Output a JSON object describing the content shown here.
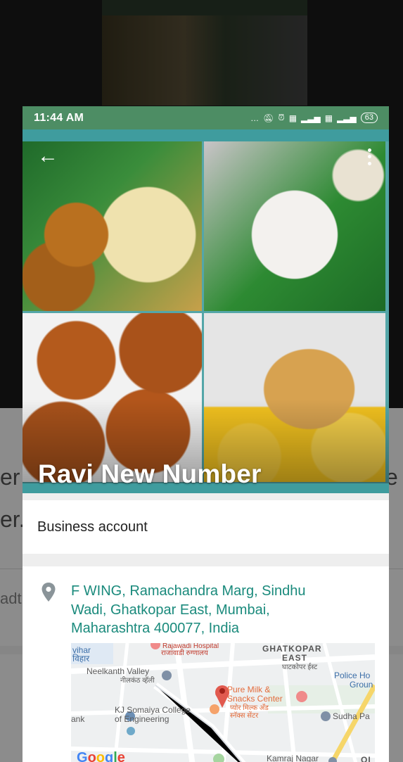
{
  "background": {
    "line1": "er .",
    "line2": "er.",
    "right_char": "e",
    "lower_text": "adt"
  },
  "status_bar": {
    "time": "11:44 AM",
    "icons": [
      "dots-icon",
      "mute-icon",
      "alarm-icon",
      "volte-icon",
      "4g-signal-icon",
      "volte-icon",
      "signal-icon"
    ],
    "battery": "63"
  },
  "hero": {
    "title": "Ravi New Number",
    "photos": [
      "medu-vada-upma-photo",
      "idiyappam-photo",
      "masala-vada-photo",
      "dosa-cone-photo"
    ]
  },
  "business": {
    "label": "Business account"
  },
  "address": {
    "text": "F WING, Ramachandra Marg, Sindhu Wadi, Ghatkopar East, Mumbai, Maharashtra 400077, India"
  },
  "map": {
    "labels": {
      "vihar": "vihar",
      "vihar_local": "विहार",
      "hospital": "Rajawadi Hospital",
      "hospital_local": "राजावाडी रुग्णालय",
      "ghatkopar": "GHATKOPAR",
      "east": "EAST",
      "ghatkopar_local": "घाटकोपर ईस्ट",
      "neelkanth": "Neelkanth Valley",
      "neelkanth_local": "नीलकंठ व्हॅली",
      "police": "Police Ho",
      "police2": "Groun",
      "pure_milk": "Pure Milk &",
      "snacks": "Snacks Center",
      "pure_local1": "प्योर मिल्क अँड",
      "pure_local2": "स्नॅक्स सेंटर",
      "kj": "KJ Somaiya College",
      "kj2": "of Engineering",
      "bank": "ank",
      "sudha": "Sudha Pa",
      "kamraj": "Kamraj Nagar",
      "ol": "OI",
      "google": "Google"
    }
  }
}
